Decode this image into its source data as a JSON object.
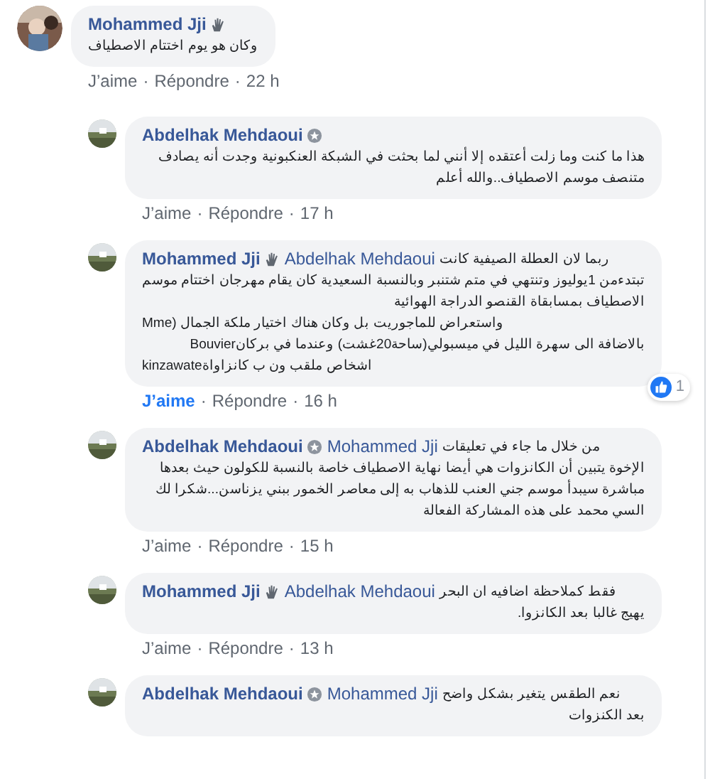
{
  "comments": [
    {
      "author": "Mohammed Jji",
      "kind": "hand",
      "text": "وكان هو يوم اختتام الاصطياف",
      "actions": {
        "like": "J’aime",
        "sep1": "·",
        "reply": "Répondre",
        "sep2": "·",
        "time": "22 h",
        "liked": false
      },
      "children": [
        {
          "author": "Abdelhak Mehdaoui",
          "kind": "shield",
          "text": "هذا ما كنت وما زلت أعتقده إلا أنني لما بحثت في الشبكة العنكبونية وجدت أنه يصادف متنصف موسم الاصطياف..والله أعلم",
          "actions": {
            "like": "J’aime",
            "sep1": "·",
            "reply": "Répondre",
            "sep2": "·",
            "time": "17 h",
            "liked": false
          }
        },
        {
          "author": "Mohammed Jji",
          "kind": "hand",
          "mention": "Abdelhak Mehdaoui",
          "lead": "ربما لان العطلة الصيفية كانت",
          "text": "تبتدءمن 1يوليوز وتنتهي في متم شتنبر وبالنسبة السعيدية كان يقام مهرجان اختتام موسم الاصطياف بمسابقاة القنصو الدراجة الهوائية\nMme) واستعراض للماجوريت بل وكان هناك اختيار ملكة الجمال\nبالاضافة الى سهرة الليل في ميسبولي(ساحة20غشت) وعندما في بركانBouvier\nkinzawateاشخاص ملقب ون ب كانزاواة",
          "reaction": {
            "count": "1"
          },
          "actions": {
            "like": "J’aime",
            "sep1": "·",
            "reply": "Répondre",
            "sep2": "·",
            "time": "16 h",
            "liked": true
          }
        },
        {
          "author": "Abdelhak Mehdaoui",
          "kind": "shield",
          "mention": "Mohammed Jji",
          "lead": "من خلال ما جاء في تعليقات",
          "text": "الإخوة يتبين أن الكانزوات هي أيضا نهاية الاصطياف خاصة بالنسبة للكولون حيث بعدها مباشرة سيبدأ موسم جني العنب للذهاب به إلى معاصر الخمور ببني يزناسن...شكرا لك السي محمد على هذه المشاركة الفعالة",
          "actions": {
            "like": "J’aime",
            "sep1": "·",
            "reply": "Répondre",
            "sep2": "·",
            "time": "15 h",
            "liked": false
          }
        },
        {
          "author": "Mohammed Jji",
          "kind": "hand",
          "mention": "Abdelhak Mehdaoui",
          "lead": "فقط كملاحظة اضافيه ان البحر",
          "text": "يهيج غالبا بعد الكانزوا.",
          "actions": {
            "like": "J’aime",
            "sep1": "·",
            "reply": "Répondre",
            "sep2": "·",
            "time": "13 h",
            "liked": false
          }
        },
        {
          "author": "Abdelhak Mehdaoui",
          "kind": "shield",
          "mention": "Mohammed Jji",
          "lead": "نعم الطقس يتغير بشكل واضح",
          "text": "بعد الكنزوات"
        }
      ]
    }
  ]
}
